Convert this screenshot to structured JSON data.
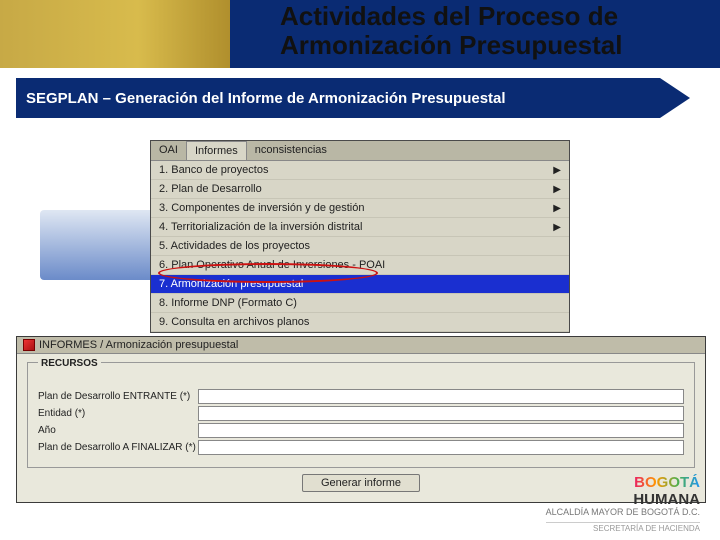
{
  "slide": {
    "title_line": "Actividades del Proceso de Armonización Presupuestal",
    "subtitle": "SEGPLAN – Generación del Informe de Armonización Presupuestal"
  },
  "menubar": {
    "items": [
      "OAI",
      "Informes",
      "nconsistencias"
    ],
    "active_index": 1
  },
  "menu": {
    "items": [
      {
        "label": "1. Banco de proyectos",
        "has_sub": true
      },
      {
        "label": "2. Plan de Desarrollo",
        "has_sub": true
      },
      {
        "label": "3. Componentes de inversión y de gestión",
        "has_sub": true
      },
      {
        "label": "4. Territorialización de la inversión distrital",
        "has_sub": true
      },
      {
        "label": "5. Actividades de los proyectos",
        "has_sub": false
      },
      {
        "label": "6. Plan Operativo Anual de Inversiones - POAI",
        "has_sub": false
      },
      {
        "label": "7. Armonización presupuestal",
        "has_sub": false,
        "selected": true
      },
      {
        "label": "8. Informe DNP (Formato C)",
        "has_sub": false
      },
      {
        "label": "9. Consulta en archivos planos",
        "has_sub": false
      }
    ]
  },
  "form": {
    "window_title": "INFORMES / Armonización presupuestal",
    "legend": "RECURSOS",
    "fields": {
      "plan_entrante": "Plan de Desarrollo ENTRANTE (*)",
      "entidad": "Entidad (*)",
      "ano": "Año",
      "plan_finalizar": "Plan de Desarrollo A FINALIZAR (*)"
    },
    "button": "Generar informe"
  },
  "footer": {
    "bogota": "BOGOTÁ",
    "humana": "HUMANA",
    "alcaldia": "ALCALDÍA MAYOR DE BOGOTÁ D.C.",
    "secretaria": "SECRETARÍA DE HACIENDA"
  }
}
